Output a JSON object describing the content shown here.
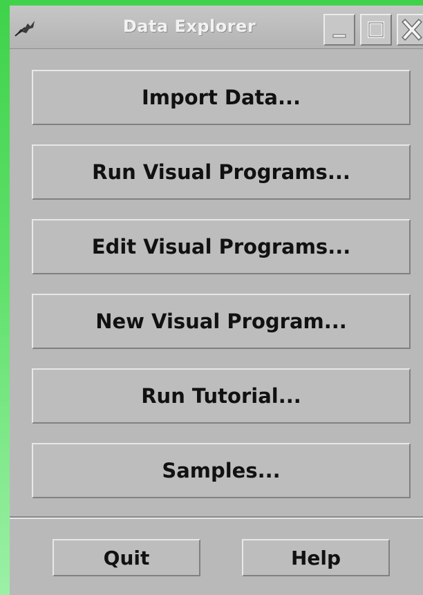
{
  "window": {
    "title": "Data Explorer",
    "icon": "feather-pen-icon",
    "controls": [
      "minimize-icon",
      "maximize-icon",
      "close-icon"
    ]
  },
  "actions": [
    {
      "label": "Import Data..."
    },
    {
      "label": "Run Visual Programs..."
    },
    {
      "label": "Edit Visual Programs..."
    },
    {
      "label": "New Visual Program..."
    },
    {
      "label": "Run Tutorial..."
    },
    {
      "label": "Samples..."
    }
  ],
  "footer": {
    "quit_label": "Quit",
    "help_label": "Help"
  },
  "colors": {
    "desktop": "#4fd95c",
    "window_bg": "#b9b9b9",
    "button_face": "#bdbdbd",
    "title_text": "#f2f2f2"
  }
}
